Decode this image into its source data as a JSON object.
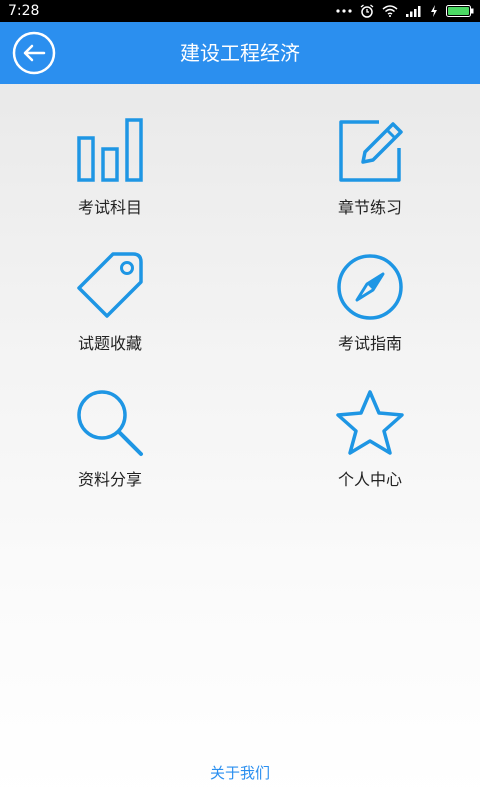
{
  "status_bar": {
    "time": "7:28",
    "icons": [
      "more-dots-icon",
      "alarm-icon",
      "wifi-icon",
      "signal-icon",
      "charging-icon",
      "battery-icon"
    ]
  },
  "header": {
    "title": "建设工程经济",
    "back_icon": "back-arrow-icon"
  },
  "menu": [
    {
      "label": "考试科目",
      "icon": "bar-chart-icon"
    },
    {
      "label": "章节练习",
      "icon": "edit-icon"
    },
    {
      "label": "试题收藏",
      "icon": "tag-icon"
    },
    {
      "label": "考试指南",
      "icon": "compass-icon"
    },
    {
      "label": "资料分享",
      "icon": "search-icon"
    },
    {
      "label": "个人中心",
      "icon": "star-icon"
    }
  ],
  "footer": {
    "about_label": "关于我们"
  },
  "colors": {
    "header_bg": "#2b8fef",
    "icon_stroke": "#1e96e4",
    "link": "#2b8fef",
    "label_text": "#222222"
  }
}
